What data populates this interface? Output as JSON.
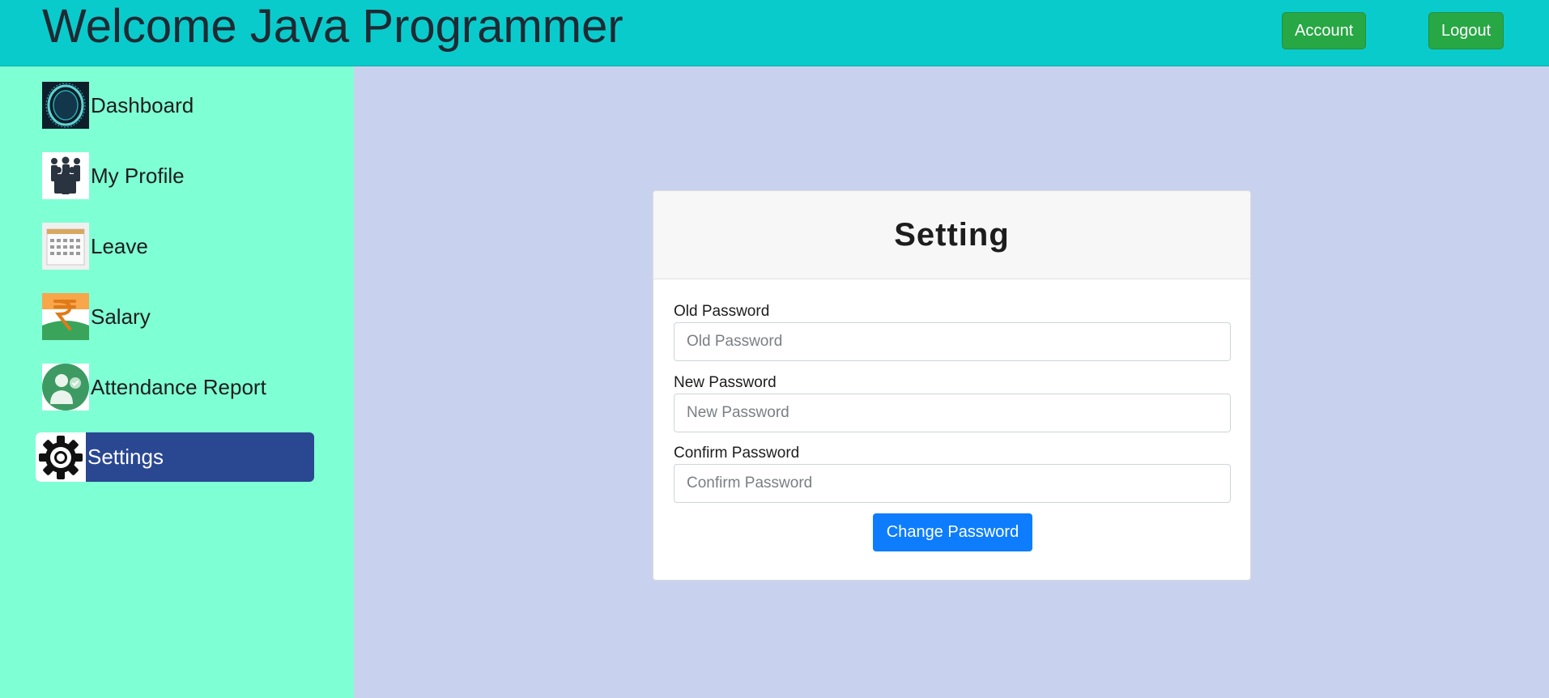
{
  "header": {
    "title": "Welcome Java Programmer",
    "account_label": "Account",
    "logout_label": "Logout",
    "accent_color": "#0acbcc",
    "button_color": "#28a745"
  },
  "sidebar": {
    "background_color": "#7fffd4",
    "active_color": "#2a4791",
    "items": [
      {
        "label": "Dashboard",
        "icon": "dashboard-icon",
        "active": false
      },
      {
        "label": "My Profile",
        "icon": "people-icon",
        "active": false
      },
      {
        "label": "Leave",
        "icon": "calendar-icon",
        "active": false
      },
      {
        "label": "Salary",
        "icon": "rupee-icon",
        "active": false
      },
      {
        "label": "Attendance Report",
        "icon": "attendance-icon",
        "active": false
      },
      {
        "label": "Settings",
        "icon": "gear-icon",
        "active": true
      }
    ]
  },
  "settings_card": {
    "title": "Setting",
    "fields": [
      {
        "label": "Old Password",
        "placeholder": "Old Password",
        "value": ""
      },
      {
        "label": "New Password",
        "placeholder": "New Password",
        "value": ""
      },
      {
        "label": "Confirm Password",
        "placeholder": "Confirm Password",
        "value": ""
      }
    ],
    "submit_label": "Change Password",
    "submit_color": "#0d7dfd"
  }
}
